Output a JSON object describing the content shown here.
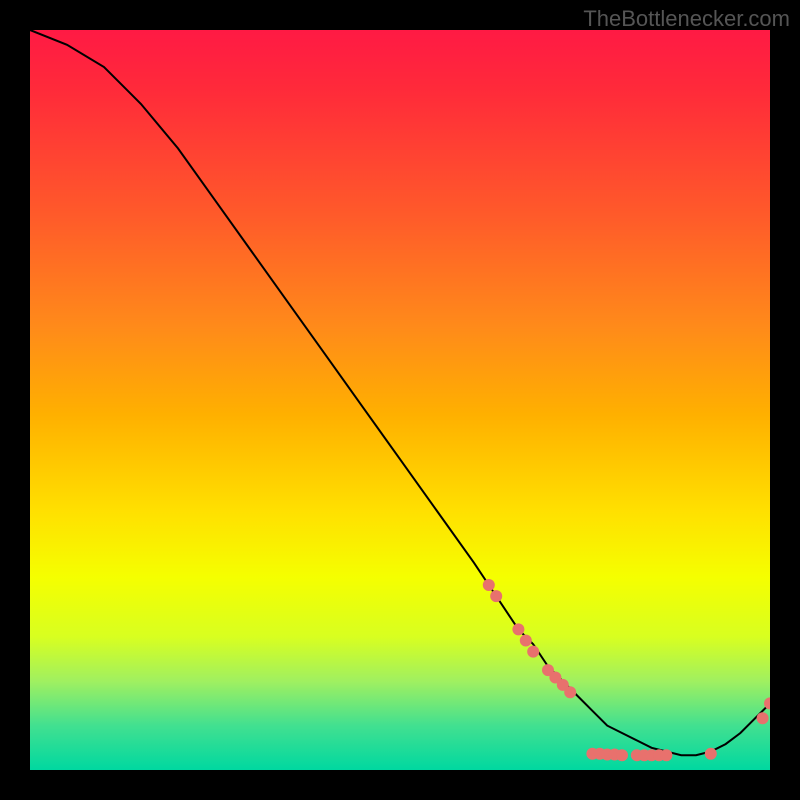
{
  "watermark": "TheBottlenecker.com",
  "chart_data": {
    "type": "line",
    "title": "",
    "xlabel": "",
    "ylabel": "",
    "xlim": [
      0,
      100
    ],
    "ylim": [
      0,
      100
    ],
    "grid": false,
    "legend": false,
    "series": [
      {
        "name": "curve",
        "x": [
          0,
          5,
          10,
          15,
          20,
          25,
          30,
          35,
          40,
          45,
          50,
          55,
          60,
          62,
          64,
          66,
          68,
          70,
          72,
          74,
          76,
          78,
          80,
          82,
          84,
          86,
          88,
          90,
          92,
          94,
          96,
          98,
          100
        ],
        "y": [
          100,
          98,
          95,
          90,
          84,
          77,
          70,
          63,
          56,
          49,
          42,
          35,
          28,
          25,
          22,
          19,
          17,
          14,
          12,
          10,
          8,
          6,
          5,
          4,
          3,
          2.5,
          2,
          2,
          2.5,
          3.5,
          5,
          7,
          9
        ]
      }
    ],
    "markers": [
      {
        "x": 62,
        "y": 25
      },
      {
        "x": 63,
        "y": 23.5
      },
      {
        "x": 66,
        "y": 19
      },
      {
        "x": 67,
        "y": 17.5
      },
      {
        "x": 68,
        "y": 16
      },
      {
        "x": 70,
        "y": 13.5
      },
      {
        "x": 71,
        "y": 12.5
      },
      {
        "x": 72,
        "y": 11.5
      },
      {
        "x": 73,
        "y": 10.5
      },
      {
        "x": 76,
        "y": 2.2
      },
      {
        "x": 77,
        "y": 2.2
      },
      {
        "x": 78,
        "y": 2.1
      },
      {
        "x": 79,
        "y": 2.1
      },
      {
        "x": 80,
        "y": 2.0
      },
      {
        "x": 82,
        "y": 2.0
      },
      {
        "x": 83,
        "y": 2.0
      },
      {
        "x": 84,
        "y": 2.0
      },
      {
        "x": 85,
        "y": 2.0
      },
      {
        "x": 86,
        "y": 2.0
      },
      {
        "x": 92,
        "y": 2.2
      },
      {
        "x": 99,
        "y": 7.0
      },
      {
        "x": 100,
        "y": 9.0
      }
    ],
    "marker_color": "#e8716d",
    "line_color": "#000000"
  }
}
